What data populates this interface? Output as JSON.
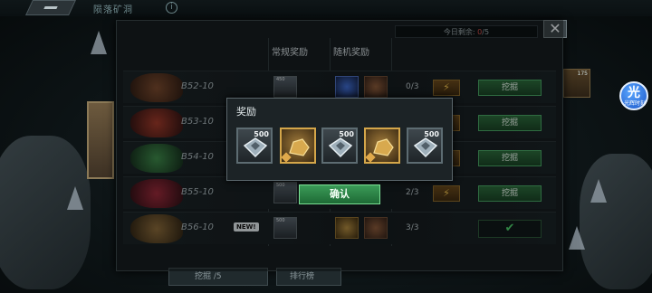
{
  "topbar": {
    "title": "陨落矿洞",
    "info_icon": "i"
  },
  "today": {
    "label": "今日剩余: ",
    "remaining": "0",
    "total": "/5"
  },
  "close_label": "✕",
  "columns": {
    "normal_reward": "常规奖励",
    "random_reward": "随机奖励"
  },
  "rows": [
    {
      "level": "B52-10",
      "progress": "0/3",
      "dig_label": "挖掘",
      "new": "",
      "normal_count": "450"
    },
    {
      "level": "B53-10",
      "progress": "",
      "dig_label": "挖掘",
      "new": ""
    },
    {
      "level": "B54-10",
      "progress": "",
      "dig_label": "挖掘",
      "new": ""
    },
    {
      "level": "B55-10",
      "progress": "2/3",
      "dig_label": "挖掘",
      "new": "",
      "normal_count": "500"
    },
    {
      "level": "B56-10",
      "progress": "3/3",
      "dig_label": "✔",
      "new": "NEW!",
      "normal_count": "500"
    }
  ],
  "reward_popup": {
    "title": "奖励",
    "items": [
      {
        "amount": "500",
        "kind": "silver"
      },
      {
        "amount": "",
        "kind": "gold"
      },
      {
        "amount": "500",
        "kind": "silver"
      },
      {
        "amount": "",
        "kind": "gold"
      },
      {
        "amount": "500",
        "kind": "silver"
      }
    ],
    "confirm_label": "确认"
  },
  "bottom": {
    "dig_tab": "挖掘  /5",
    "rank_tab": "排行榜"
  },
  "side_badge": {
    "glyph": "光",
    "label": "光辉时刻"
  },
  "right_thumb_count": "175",
  "colors": {
    "accent_green": "#2c6b3c",
    "gold": "#d4a64a",
    "remaining_red": "#d9534f"
  }
}
